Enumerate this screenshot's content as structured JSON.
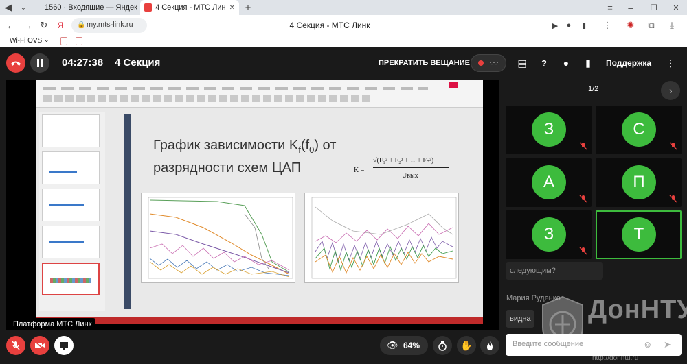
{
  "browser": {
    "tabs": [
      {
        "label": "1560 · Входящие — Яндек"
      },
      {
        "label": "4 Секция - МТС Лин"
      }
    ],
    "address": "my.mts-link.ru",
    "page_title": "4 Секция - МТС Линк",
    "bookmarks": [
      "Wi-Fi OVS"
    ]
  },
  "app": {
    "timer": "04:27:38",
    "section_title": "4 Секция",
    "stop_broadcast": "ПРЕКРАТИТЬ ВЕЩАНИЕ",
    "support": "Поддержка",
    "page_indicator": "1/2",
    "platform_label": "Платформа МТС Линк",
    "views_percent": "64%",
    "chat_placeholder": "Введите сообщение",
    "chat": {
      "msg1": "следующим?",
      "author": "Мария Руденко",
      "msg2": "видна"
    },
    "watermark": "ДонНТУ",
    "watermark_sub": "http://donntu.ru",
    "participants": [
      {
        "initial": "З",
        "muted": true
      },
      {
        "initial": "С",
        "muted": true
      },
      {
        "initial": "А",
        "muted": true
      },
      {
        "initial": "П",
        "muted": true
      },
      {
        "initial": "З",
        "muted": true
      },
      {
        "initial": "Т",
        "muted": false,
        "active": true
      }
    ]
  },
  "slide": {
    "title_line1": "График зависимости K",
    "title_sub": "f",
    "title_tail": "(f",
    "title_sub2": "0",
    "title_end": ") от",
    "title_line2": "разрядности схем ЦАП",
    "formula_left": "K =",
    "formula_top": "√(F₁² + F₂² + ... + Fₙ²)",
    "formula_bottom": "Uвых"
  },
  "colors": {
    "accent_green": "#3dbb3d",
    "hangup_red": "#e8403e",
    "slide_bar": "#3a4a66"
  }
}
